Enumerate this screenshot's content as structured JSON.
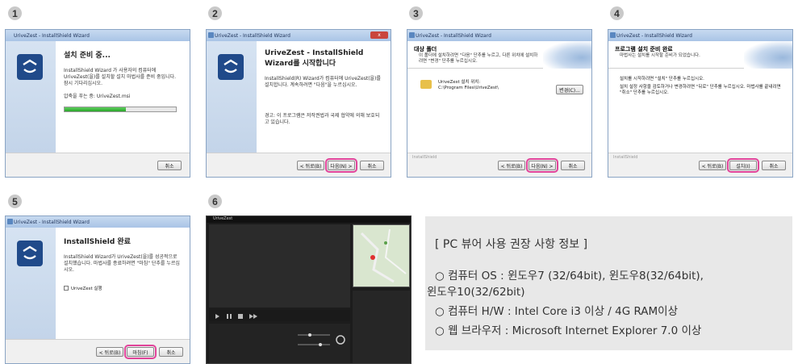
{
  "steps": [
    "1",
    "2",
    "3",
    "4",
    "5",
    "6"
  ],
  "window_title": "UriveZest - InstallShield Wizard",
  "close_glyph": "x",
  "w1": {
    "heading": "설치 준비 중...",
    "para": "InstallShield Wizard 가 사용자의 컴퓨터에 UriveZest(을)를 설치할 설치 마법사를 준비 중입니다. 잠시 기다리십시오.",
    "status": "압축을 푸는 중: UriveZest.msi",
    "progress": 0.55,
    "cancel": "취소"
  },
  "w2": {
    "heading": "UriveZest - InstallShield Wizard를 시작합니다",
    "para1": "InstallShield(R) Wizard가 컴퓨터에 UriveZest(을)를 설치합니다. 계속하려면 \"다음\"을 누르십시오.",
    "para2": "경고: 이 프로그램은 저작권법과 국제 협약에 의해 보호되고 있습니다.",
    "back": "< 뒤로(B)",
    "next": "다음(N) >",
    "cancel": "취소"
  },
  "w3": {
    "title": "대상 폴더",
    "subtitle": "이 폴더에 설치하려면 \"다음\" 단추를 누르고, 다른 위치에 설치하려면 \"변경\" 단추를 누르십시오.",
    "folder_label": "UriveZest 설치 위치:",
    "folder_path": "C:\\Program Files\\UriveZest\\",
    "change": "변경(C)...",
    "brand": "InstallShield",
    "back": "< 뒤로(B)",
    "next": "다음(N) >",
    "cancel": "취소"
  },
  "w4": {
    "title": "프로그램 설치 준비 완료",
    "subtitle": "마법사는 설치를 시작할 준비가 되었습니다.",
    "para1": "설치를 시작하려면 \"설치\" 단추를 누르십시오.",
    "para2": "설치 설정 사항을 검토하거나 변경하려면 \"뒤로\" 단추를 누르십시오. 마법사를 끝내려면 \"취소\" 단추를 누르십시오.",
    "brand": "InstallShield",
    "back": "< 뒤로(B)",
    "install": "설치(I)",
    "cancel": "취소"
  },
  "w5": {
    "heading": "InstallShield 완료",
    "para": "InstallShield Wizard가 UriveZest(을)를 성공적으로 설치했습니다. 마법사를 종료하려면 \"마침\" 단추를 누르십시오.",
    "checkbox_label": "UriveZest 실행",
    "back": "< 뒤로(B)",
    "finish": "마침(F)",
    "cancel": "취소"
  },
  "viewer": {
    "app_name": "UriveZest"
  },
  "specs": {
    "title": "[ PC 뷰어 사용 권장 사항 정보 ]",
    "os_line1": "○ 컴퓨터 OS : 윈도우7 (32/64bit), 윈도우8(32/64bit),",
    "os_line2": "윈도우10(32/62bit)",
    "hw_line": "○ 컴퓨터 H/W : Intel Core i3 이상 / 4G RAM이상",
    "browser_line": "○ 웹 브라우저 : Microsoft Internet Explorer 7.0 이상"
  }
}
